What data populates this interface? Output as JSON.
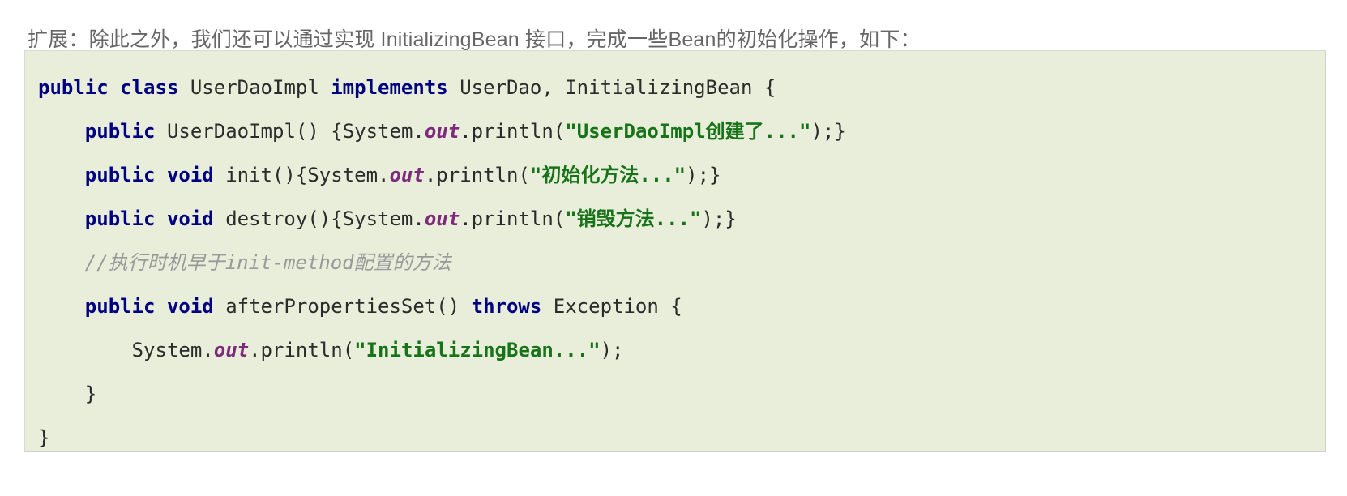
{
  "document": {
    "intro": "扩展：除此之外，我们还可以通过实现 InitializingBean 接口，完成一些Bean的初始化操作，如下：",
    "colors": {
      "page_background": "#ffffff",
      "code_background": "#e9eedb",
      "code_border": "#d9d9d9",
      "intro_text": "#666666",
      "keyword": "#000080",
      "string": "#177317",
      "field": "#7d2a7d",
      "comment": "#999999",
      "plain": "#2b2b2b"
    },
    "code_block": {
      "language": "java",
      "lines": [
        {
          "indent": 0,
          "tokens": [
            {
              "type": "kw",
              "text": "public class "
            },
            {
              "type": "pln",
              "text": "UserDaoImpl "
            },
            {
              "type": "kw",
              "text": "implements "
            },
            {
              "type": "pln",
              "text": "UserDao, InitializingBean {"
            }
          ]
        },
        {
          "indent": 1,
          "tokens": [
            {
              "type": "kw",
              "text": "public "
            },
            {
              "type": "pln",
              "text": "UserDaoImpl() {System."
            },
            {
              "type": "fld",
              "text": "out"
            },
            {
              "type": "pln",
              "text": ".println("
            },
            {
              "type": "str",
              "text": "\"UserDaoImpl创建了...\""
            },
            {
              "type": "pln",
              "text": ");}"
            }
          ]
        },
        {
          "indent": 1,
          "tokens": [
            {
              "type": "kw",
              "text": "public void "
            },
            {
              "type": "pln",
              "text": "init(){System."
            },
            {
              "type": "fld",
              "text": "out"
            },
            {
              "type": "pln",
              "text": ".println("
            },
            {
              "type": "str",
              "text": "\"初始化方法...\""
            },
            {
              "type": "pln",
              "text": ");}"
            }
          ]
        },
        {
          "indent": 1,
          "tokens": [
            {
              "type": "kw",
              "text": "public void "
            },
            {
              "type": "pln",
              "text": "destroy(){System."
            },
            {
              "type": "fld",
              "text": "out"
            },
            {
              "type": "pln",
              "text": ".println("
            },
            {
              "type": "str",
              "text": "\"销毁方法...\""
            },
            {
              "type": "pln",
              "text": ");}"
            }
          ]
        },
        {
          "indent": 1,
          "tokens": [
            {
              "type": "cmt",
              "text": "//执行时机早于init-method配置的方法"
            }
          ]
        },
        {
          "indent": 1,
          "tokens": [
            {
              "type": "kw",
              "text": "public void "
            },
            {
              "type": "pln",
              "text": "afterPropertiesSet() "
            },
            {
              "type": "kw",
              "text": "throws "
            },
            {
              "type": "pln",
              "text": "Exception {"
            }
          ]
        },
        {
          "indent": 2,
          "tokens": [
            {
              "type": "pln",
              "text": "System."
            },
            {
              "type": "fld",
              "text": "out"
            },
            {
              "type": "pln",
              "text": ".println("
            },
            {
              "type": "str",
              "text": "\"InitializingBean...\""
            },
            {
              "type": "pln",
              "text": ");"
            }
          ]
        },
        {
          "indent": 1,
          "tokens": [
            {
              "type": "pln",
              "text": "}"
            }
          ]
        },
        {
          "indent": 0,
          "tokens": [
            {
              "type": "pln",
              "text": "}"
            }
          ]
        }
      ]
    }
  }
}
